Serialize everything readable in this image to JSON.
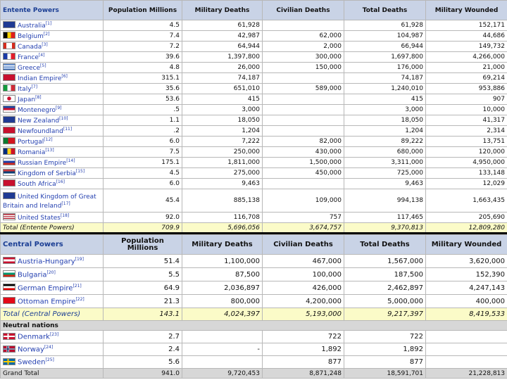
{
  "headers": {
    "population": "Population Millions",
    "military_deaths": "Military Deaths",
    "civilian_deaths": "Civilian Deaths",
    "total_deaths": "Total Deaths",
    "military_wounded": "Military Wounded"
  },
  "entente": {
    "title": "Entente Powers",
    "rows": [
      {
        "name": "Australia",
        "ref": "[1]",
        "flag": "australia",
        "pop": "4.5",
        "mil": "61,928",
        "civ": "",
        "tot": "61,928",
        "wnd": "152,171"
      },
      {
        "name": "Belgium",
        "ref": "[2]",
        "flag": "belgium",
        "pop": "7.4",
        "mil": "42,987",
        "civ": "62,000",
        "tot": "104,987",
        "wnd": "44,686"
      },
      {
        "name": "Canada",
        "ref": "[3]",
        "flag": "canada",
        "pop": "7.2",
        "mil": "64,944",
        "civ": "2,000",
        "tot": "66,944",
        "wnd": "149,732"
      },
      {
        "name": "France",
        "ref": "[4]",
        "flag": "france",
        "pop": "39.6",
        "mil": "1,397,800",
        "civ": "300,000",
        "tot": "1,697,800",
        "wnd": "4,266,000"
      },
      {
        "name": "Greece",
        "ref": "[5]",
        "flag": "greece",
        "pop": "4.8",
        "mil": "26,000",
        "civ": "150,000",
        "tot": "176,000",
        "wnd": "21,000"
      },
      {
        "name": "Indian Empire",
        "ref": "[6]",
        "flag": "india",
        "pop": "315.1",
        "mil": "74,187",
        "civ": "",
        "tot": "74,187",
        "wnd": "69,214"
      },
      {
        "name": "Italy",
        "ref": "[7]",
        "flag": "italy",
        "pop": "35.6",
        "mil": "651,010",
        "civ": "589,000",
        "tot": "1,240,010",
        "wnd": "953,886"
      },
      {
        "name": "Japan",
        "ref": "[8]",
        "flag": "japan",
        "pop": "53.6",
        "mil": "415",
        "civ": "",
        "tot": "415",
        "wnd": "907"
      },
      {
        "name": "Montenegro",
        "ref": "[9]",
        "flag": "montenegro",
        "pop": ".5",
        "mil": "3,000",
        "civ": "",
        "tot": "3,000",
        "wnd": "10,000"
      },
      {
        "name": "New Zealand",
        "ref": "[10]",
        "flag": "newzealand",
        "pop": "1.1",
        "mil": "18,050",
        "civ": "",
        "tot": "18,050",
        "wnd": "41,317"
      },
      {
        "name": "Newfoundland",
        "ref": "[11]",
        "flag": "newfoundland",
        "pop": ".2",
        "mil": "1,204",
        "civ": "",
        "tot": "1,204",
        "wnd": "2,314"
      },
      {
        "name": "Portugal",
        "ref": "[12]",
        "flag": "portugal",
        "pop": "6.0",
        "mil": "7,222",
        "civ": "82,000",
        "tot": "89,222",
        "wnd": "13,751"
      },
      {
        "name": "Romania",
        "ref": "[13]",
        "flag": "romania",
        "pop": "7.5",
        "mil": "250,000",
        "civ": "430,000",
        "tot": "680,000",
        "wnd": "120,000"
      },
      {
        "name": "Russian Empire",
        "ref": "[14]",
        "flag": "russia",
        "pop": "175.1",
        "mil": "1,811,000",
        "civ": "1,500,000",
        "tot": "3,311,000",
        "wnd": "4,950,000"
      },
      {
        "name": "Kingdom of Serbia",
        "ref": "[15]",
        "flag": "serbia",
        "pop": "4.5",
        "mil": "275,000",
        "civ": "450,000",
        "tot": "725,000",
        "wnd": "133,148"
      },
      {
        "name": "South Africa",
        "ref": "[16]",
        "flag": "southafrica",
        "pop": "6.0",
        "mil": "9,463",
        "civ": "",
        "tot": "9,463",
        "wnd": "12,029"
      },
      {
        "name": "United Kingdom of Great Britain and Ireland",
        "ref": "[17]",
        "flag": "uk",
        "pop": "45.4",
        "mil": "885,138",
        "civ": "109,000",
        "tot": "994,138",
        "wnd": "1,663,435"
      },
      {
        "name": "United States",
        "ref": "[18]",
        "flag": "usa",
        "pop": "92.0",
        "mil": "116,708",
        "civ": "757",
        "tot": "117,465",
        "wnd": "205,690"
      }
    ],
    "total": {
      "label": "Total (Entente Powers)",
      "pop": "709.9",
      "mil": "5,696,056",
      "civ": "3,674,757",
      "tot": "9,370,813",
      "wnd": "12,809,280"
    }
  },
  "central": {
    "title": "Central Powers",
    "rows": [
      {
        "name": "Austria-Hungary",
        "ref": "[19]",
        "flag": "austria",
        "pop": "51.4",
        "mil": "1,100,000",
        "civ": "467,000",
        "tot": "1,567,000",
        "wnd": "3,620,000"
      },
      {
        "name": "Bulgaria",
        "ref": "[20]",
        "flag": "bulgaria",
        "pop": "5.5",
        "mil": "87,500",
        "civ": "100,000",
        "tot": "187,500",
        "wnd": "152,390"
      },
      {
        "name": "German Empire",
        "ref": "[21]",
        "flag": "germany",
        "pop": "64.9",
        "mil": "2,036,897",
        "civ": "426,000",
        "tot": "2,462,897",
        "wnd": "4,247,143"
      },
      {
        "name": "Ottoman Empire",
        "ref": "[22]",
        "flag": "ottoman",
        "pop": "21.3",
        "mil": "800,000",
        "civ": "4,200,000",
        "tot": "5,000,000",
        "wnd": "400,000"
      }
    ],
    "total": {
      "label": "Total (Central Powers)",
      "pop": "143.1",
      "mil": "4,024,397",
      "civ": "5,193,000",
      "tot": "9,217,397",
      "wnd": "8,419,533"
    }
  },
  "neutral": {
    "title": "Neutral nations",
    "rows": [
      {
        "name": "Denmark",
        "ref": "[23]",
        "flag": "denmark",
        "pop": "2.7",
        "mil": "",
        "civ": "722",
        "tot": "722",
        "wnd": ""
      },
      {
        "name": "Norway",
        "ref": "[24]",
        "flag": "norway",
        "pop": "2.4",
        "mil": "-",
        "civ": "1,892",
        "tot": "1,892",
        "wnd": ""
      },
      {
        "name": "Sweden",
        "ref": "[25]",
        "flag": "sweden",
        "pop": "5.6",
        "mil": "",
        "civ": "877",
        "tot": "877",
        "wnd": ""
      }
    ]
  },
  "grand_total": {
    "label": "Grand Total",
    "pop": "941.0",
    "mil": "9,720,453",
    "civ": "8,871,248",
    "tot": "18,591,701",
    "wnd": "21,228,813"
  }
}
